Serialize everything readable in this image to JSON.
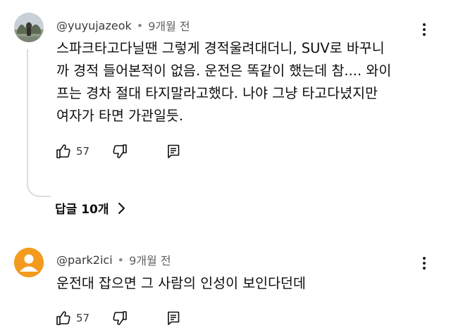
{
  "comments": [
    {
      "handle": "@yuyujazeok",
      "time": "9개월 전",
      "text_lines": [
        "스파크타고다닐땐 그렇게 경적울려대더니, SUV로 바꾸니",
        "까 경적 들어본적이 없음. 운전은 똑같이 했는데 참.... 와이",
        "프는 경차 절대 타지말라고했다. 나야 그냥 타고다녔지만",
        "여자가 타면 가관일듯."
      ],
      "likes": "57",
      "replies_label": "답글 10개",
      "icons": [
        "thumb-up-icon",
        "thumb-down-icon",
        "reply-icon",
        "more-vert-icon",
        "chevron-right-icon"
      ]
    },
    {
      "handle": "@park2ici",
      "time": "9개월 전",
      "text": "운전대 잡으면 그 사람의 인성이 보인다던데",
      "likes": "57",
      "avatar_color": "#f39a1f",
      "icons": [
        "thumb-up-icon",
        "thumb-down-icon",
        "reply-icon",
        "more-vert-icon"
      ]
    }
  ],
  "meta_separator": "•"
}
